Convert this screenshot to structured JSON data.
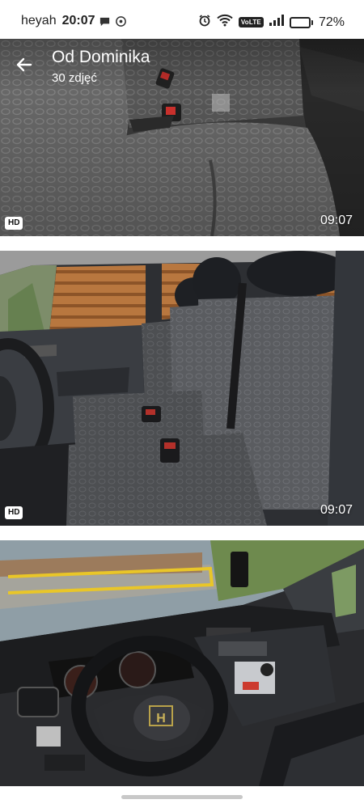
{
  "status_bar": {
    "carrier": "heyah",
    "time": "20:07",
    "volte": "VoLTE",
    "battery": "72%",
    "battery_level": 0.72
  },
  "header": {
    "title": "Od Dominika",
    "subtitle": "30 zdjęć"
  },
  "photos": [
    {
      "badge": "HD",
      "duration": "09:07"
    },
    {
      "badge": "HD",
      "duration": "09:07"
    },
    {
      "badge": "",
      "duration": ""
    }
  ],
  "steering_logo": "H",
  "colors": {
    "accent": "#ffffff",
    "background": "#ffffff"
  },
  "icons": [
    "message-icon",
    "whatsapp-icon",
    "alarm-icon",
    "wifi-icon",
    "signal-icon",
    "battery-icon",
    "back-arrow-icon"
  ]
}
